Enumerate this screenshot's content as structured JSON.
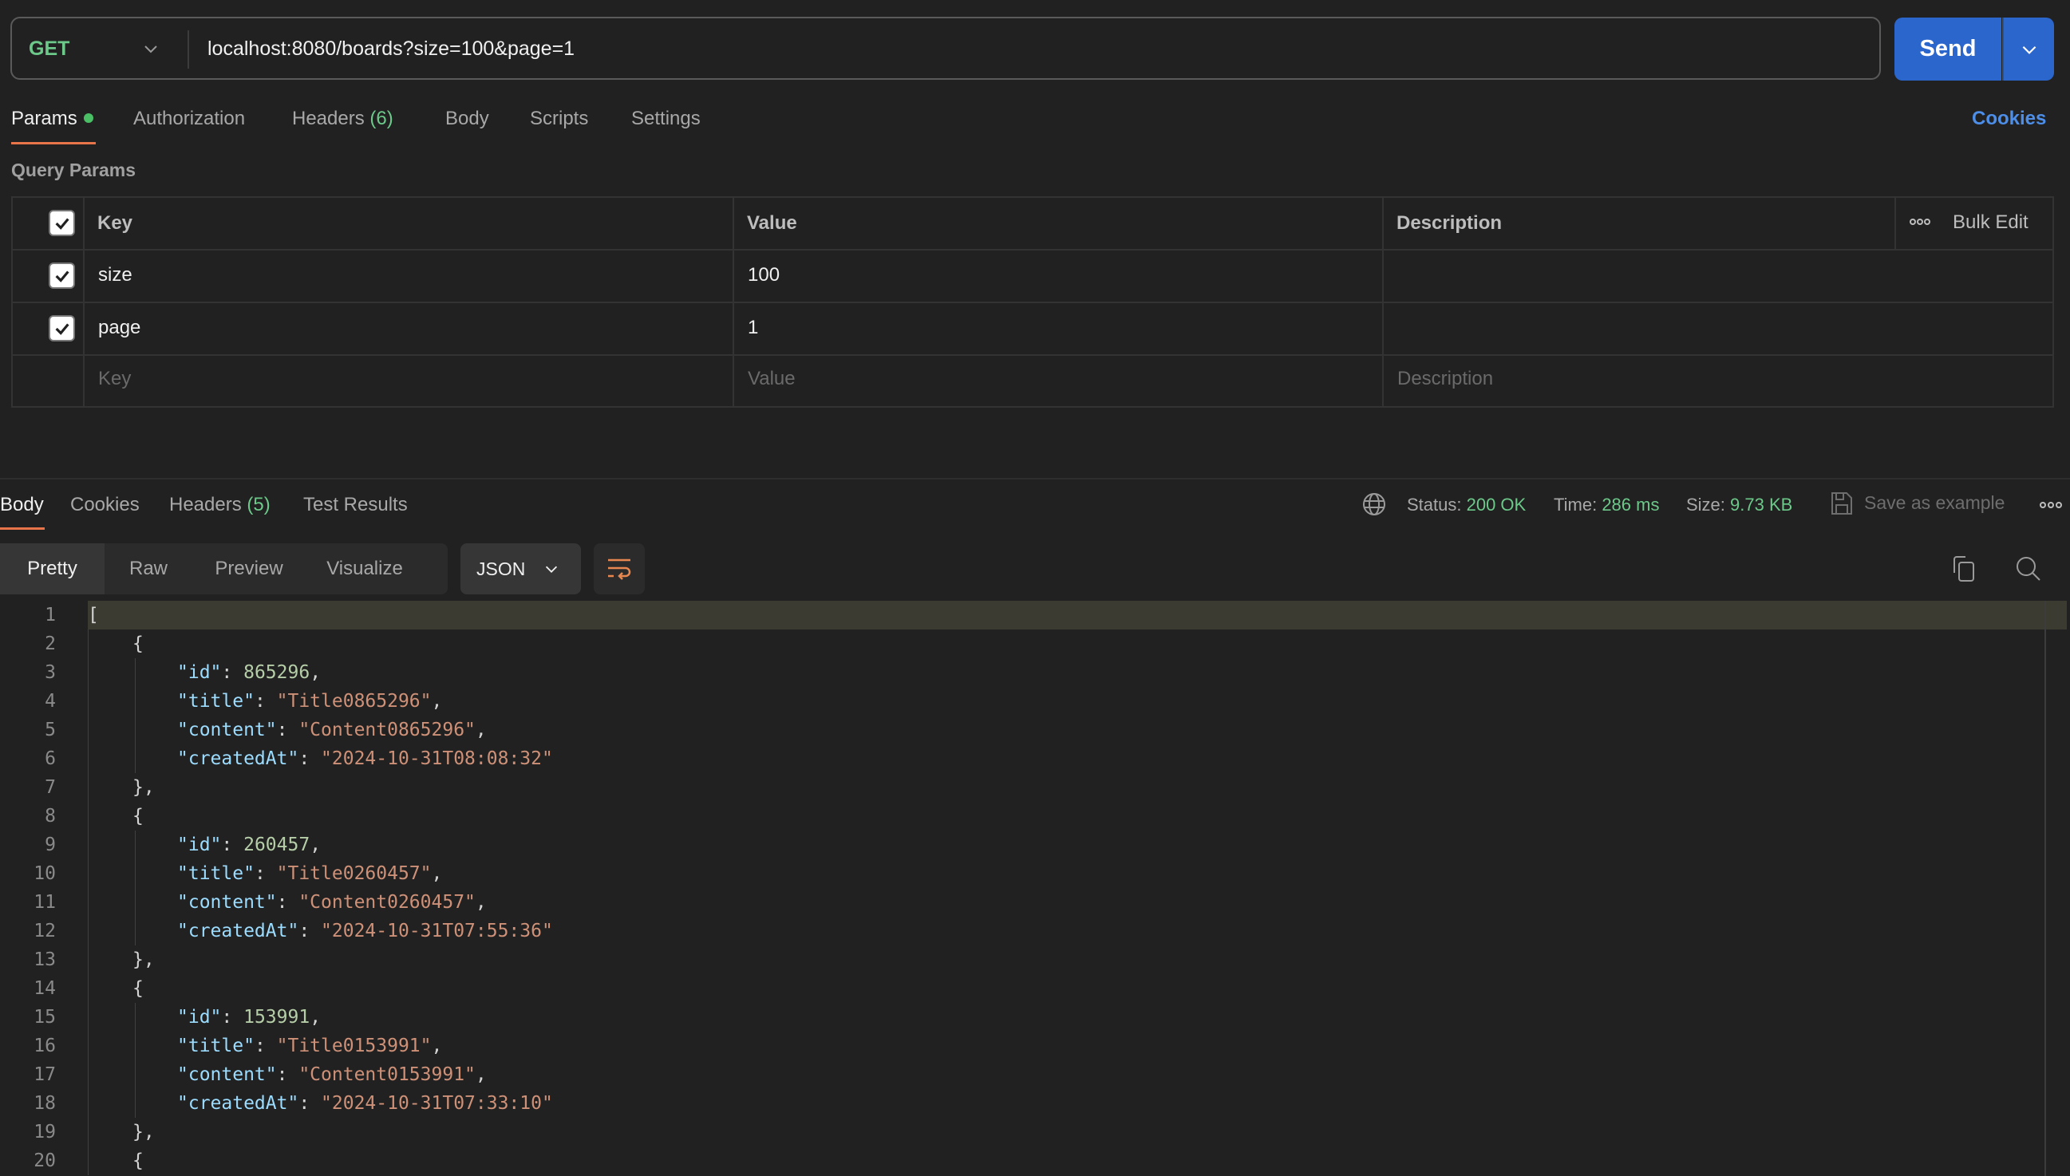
{
  "request": {
    "method": "GET",
    "url": "localhost:8080/boards?size=100&page=1",
    "send_label": "Send",
    "tabs": [
      {
        "label": "Params",
        "active": true,
        "indicator": true
      },
      {
        "label": "Authorization"
      },
      {
        "label": "Headers",
        "count": "(6)"
      },
      {
        "label": "Body"
      },
      {
        "label": "Scripts"
      },
      {
        "label": "Settings"
      }
    ],
    "cookies_label": "Cookies",
    "query_params_label": "Query Params",
    "table": {
      "headers": {
        "key": "Key",
        "value": "Value",
        "description": "Description",
        "bulk_edit": "Bulk Edit"
      },
      "rows": [
        {
          "checked": true,
          "key": "size",
          "value": "100",
          "description": ""
        },
        {
          "checked": true,
          "key": "page",
          "value": "1",
          "description": ""
        }
      ],
      "placeholders": {
        "key": "Key",
        "value": "Value",
        "description": "Description"
      }
    }
  },
  "response": {
    "tabs": [
      {
        "label": "Body",
        "active": true
      },
      {
        "label": "Cookies"
      },
      {
        "label": "Headers",
        "count": "(5)"
      },
      {
        "label": "Test Results"
      }
    ],
    "status_label": "Status:",
    "status_value": "200 OK",
    "time_label": "Time:",
    "time_value": "286 ms",
    "size_label": "Size:",
    "size_value": "9.73 KB",
    "save_example_label": "Save as example",
    "views": [
      "Pretty",
      "Raw",
      "Preview",
      "Visualize"
    ],
    "active_view": "Pretty",
    "format": "JSON",
    "colors": {
      "accent": "#e8744a",
      "success": "#6cc98a",
      "send": "#2b66cc",
      "link": "#4d8ee8"
    },
    "body_lines": [
      {
        "n": "1",
        "indent": 0,
        "tokens": [
          [
            "p",
            "["
          ]
        ]
      },
      {
        "n": "2",
        "indent": 1,
        "tokens": [
          [
            "p",
            "{"
          ]
        ]
      },
      {
        "n": "3",
        "indent": 2,
        "tokens": [
          [
            "k",
            "\"id\""
          ],
          [
            "p",
            ": "
          ],
          [
            "n",
            "865296"
          ],
          [
            "p",
            ","
          ]
        ]
      },
      {
        "n": "4",
        "indent": 2,
        "tokens": [
          [
            "k",
            "\"title\""
          ],
          [
            "p",
            ": "
          ],
          [
            "s",
            "\"Title0865296\""
          ],
          [
            "p",
            ","
          ]
        ]
      },
      {
        "n": "5",
        "indent": 2,
        "tokens": [
          [
            "k",
            "\"content\""
          ],
          [
            "p",
            ": "
          ],
          [
            "s",
            "\"Content0865296\""
          ],
          [
            "p",
            ","
          ]
        ]
      },
      {
        "n": "6",
        "indent": 2,
        "tokens": [
          [
            "k",
            "\"createdAt\""
          ],
          [
            "p",
            ": "
          ],
          [
            "s",
            "\"2024-10-31T08:08:32\""
          ]
        ]
      },
      {
        "n": "7",
        "indent": 1,
        "tokens": [
          [
            "p",
            "},"
          ]
        ]
      },
      {
        "n": "8",
        "indent": 1,
        "tokens": [
          [
            "p",
            "{"
          ]
        ]
      },
      {
        "n": "9",
        "indent": 2,
        "tokens": [
          [
            "k",
            "\"id\""
          ],
          [
            "p",
            ": "
          ],
          [
            "n",
            "260457"
          ],
          [
            "p",
            ","
          ]
        ]
      },
      {
        "n": "10",
        "indent": 2,
        "tokens": [
          [
            "k",
            "\"title\""
          ],
          [
            "p",
            ": "
          ],
          [
            "s",
            "\"Title0260457\""
          ],
          [
            "p",
            ","
          ]
        ]
      },
      {
        "n": "11",
        "indent": 2,
        "tokens": [
          [
            "k",
            "\"content\""
          ],
          [
            "p",
            ": "
          ],
          [
            "s",
            "\"Content0260457\""
          ],
          [
            "p",
            ","
          ]
        ]
      },
      {
        "n": "12",
        "indent": 2,
        "tokens": [
          [
            "k",
            "\"createdAt\""
          ],
          [
            "p",
            ": "
          ],
          [
            "s",
            "\"2024-10-31T07:55:36\""
          ]
        ]
      },
      {
        "n": "13",
        "indent": 1,
        "tokens": [
          [
            "p",
            "},"
          ]
        ]
      },
      {
        "n": "14",
        "indent": 1,
        "tokens": [
          [
            "p",
            "{"
          ]
        ]
      },
      {
        "n": "15",
        "indent": 2,
        "tokens": [
          [
            "k",
            "\"id\""
          ],
          [
            "p",
            ": "
          ],
          [
            "n",
            "153991"
          ],
          [
            "p",
            ","
          ]
        ]
      },
      {
        "n": "16",
        "indent": 2,
        "tokens": [
          [
            "k",
            "\"title\""
          ],
          [
            "p",
            ": "
          ],
          [
            "s",
            "\"Title0153991\""
          ],
          [
            "p",
            ","
          ]
        ]
      },
      {
        "n": "17",
        "indent": 2,
        "tokens": [
          [
            "k",
            "\"content\""
          ],
          [
            "p",
            ": "
          ],
          [
            "s",
            "\"Content0153991\""
          ],
          [
            "p",
            ","
          ]
        ]
      },
      {
        "n": "18",
        "indent": 2,
        "tokens": [
          [
            "k",
            "\"createdAt\""
          ],
          [
            "p",
            ": "
          ],
          [
            "s",
            "\"2024-10-31T07:33:10\""
          ]
        ]
      },
      {
        "n": "19",
        "indent": 1,
        "tokens": [
          [
            "p",
            "},"
          ]
        ]
      },
      {
        "n": "20",
        "indent": 1,
        "tokens": [
          [
            "p",
            "{"
          ]
        ]
      }
    ]
  }
}
